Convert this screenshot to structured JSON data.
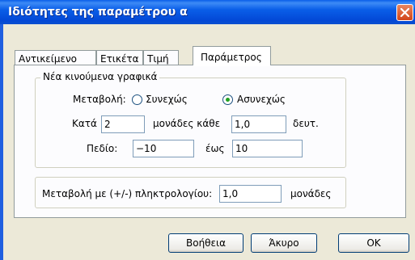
{
  "window": {
    "title": "Ιδιότητες της παραμέτρου α"
  },
  "tabs": [
    {
      "label": "Αντικείμενο"
    },
    {
      "label": "Ετικέτα"
    },
    {
      "label": "Τιμή"
    },
    {
      "label": "Παράμετρος",
      "active": true
    }
  ],
  "animation_group": {
    "legend": "Νέα κινούμενα γραφικά",
    "change_label": "Μεταβολή:",
    "continuous_label": "Συνεχώς",
    "discrete_label": "Ασυνεχώς",
    "selected": "Ασυνεχώς",
    "by_label": "Κατά",
    "by_value": "2",
    "units_every_label": "μονάδες κάθε",
    "every_value": "1,0",
    "sec_label": "δευτ.",
    "range_label": "Πεδίο:",
    "from_value": "−10",
    "to_label": "έως",
    "to_value": "10"
  },
  "keyboard_group": {
    "label": "Μεταβολή με (+/-) πληκτρολογίου:",
    "value": "1,0",
    "units_label": "μονάδες"
  },
  "buttons": {
    "help": "Βοήθεια",
    "cancel": "Άκυρο",
    "ok": "OK"
  }
}
